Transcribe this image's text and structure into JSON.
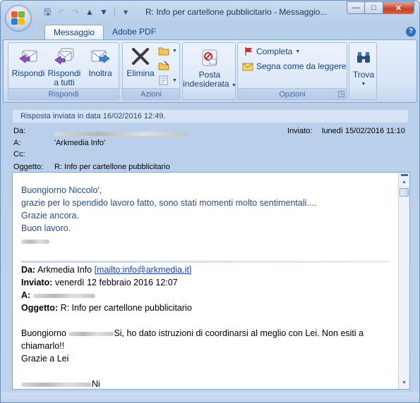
{
  "window": {
    "title": "R: Info per cartellone pubblicitario - Messaggio..."
  },
  "tabs": [
    {
      "label": "Messaggio"
    },
    {
      "label": "Adobe PDF"
    }
  ],
  "ribbon": {
    "rispondi_group": {
      "label": "Rispondi",
      "reply": "Rispondi",
      "reply_all_line1": "Rispondi",
      "reply_all_line2": "a tutti",
      "forward": "Inoltra"
    },
    "azioni_group": {
      "label": "Azioni",
      "delete": "Elimina"
    },
    "junk": {
      "line1": "Posta",
      "line2": "indesiderata"
    },
    "opzioni_group": {
      "label": "Opzioni",
      "complete": "Completa",
      "mark_unread": "Segna come da leggere"
    },
    "find": {
      "label": "Trova"
    }
  },
  "info_bar": {
    "text": "Risposta inviata in data 16/02/2016 12:49."
  },
  "header": {
    "from_label": "Da:",
    "to_label": "A:",
    "to_value": "'Arkmedia Info'",
    "cc_label": "Cc:",
    "subject_label": "Oggetto:",
    "subject_value": "R: Info per cartellone pubblicitario",
    "sent_label": "Inviato:",
    "sent_value": "lunedì 15/02/2016 11:10"
  },
  "body": {
    "greeting": "Buongiorno Niccolo',",
    "line1": "grazie per lo spendido lavoro fatto, sono stati momenti molto sentimentali....",
    "line2": "Grazie ancora.",
    "line3": "Buon lavoro.",
    "quoted": {
      "from_label": "Da:",
      "from_name": "Arkmedia Info",
      "from_link": "[mailto:info@arkmedia.it]",
      "sent_label": "Inviato:",
      "sent_value": "venerdì 12 febbraio 2016 12:07",
      "to_label": "A:",
      "subject_label": "Oggetto:",
      "subject_value": "R: Info per cartellone pubblicitario",
      "greeting_start": "Buongiorno",
      "greeting_rest": "Si, ho dato istruzioni di coordinarsi al meglio con Lei. Non esiti a chiamarlo!!",
      "closing": "Grazie a Lei",
      "signature_suffix": "Ni"
    }
  }
}
